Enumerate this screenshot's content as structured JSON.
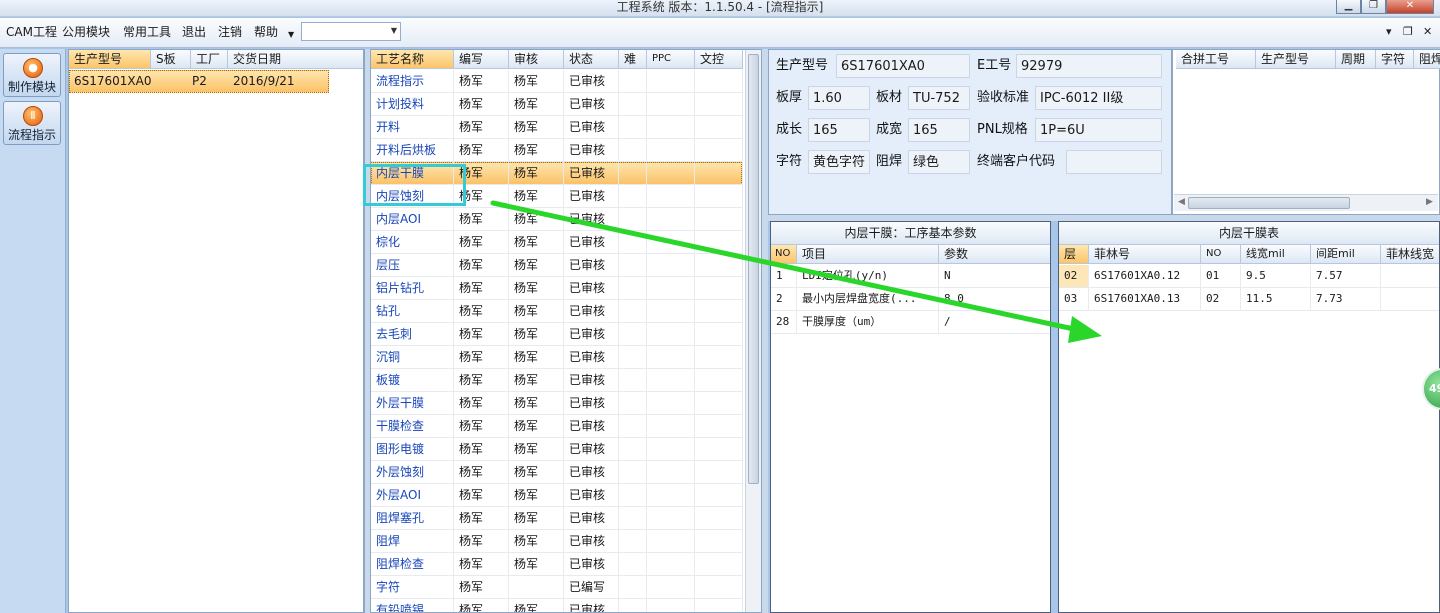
{
  "window": {
    "title": "工程系统  版本：1.1.50.4 - [流程指示]"
  },
  "menu": {
    "items": [
      "CAM工程",
      "公用模块",
      "常用工具",
      "退出",
      "注销",
      "帮助"
    ],
    "combo_value": ""
  },
  "nav": {
    "buttons": [
      {
        "label": "制作模块",
        "icon": "record-icon"
      },
      {
        "label": "流程指示",
        "icon": "pause-icon"
      }
    ]
  },
  "orders": {
    "columns": [
      "生产型号",
      "S板",
      "工厂",
      "交货日期"
    ],
    "rows": [
      [
        "6S17601XA0",
        "",
        "P2",
        "2016/9/21"
      ]
    ]
  },
  "process": {
    "columns": [
      "工艺名称",
      "编写",
      "审核",
      "状态",
      "难",
      "PPC",
      "文控"
    ],
    "rows": [
      [
        "流程指示",
        "杨军",
        "杨军",
        "已审核"
      ],
      [
        "计划投料",
        "杨军",
        "杨军",
        "已审核"
      ],
      [
        "开料",
        "杨军",
        "杨军",
        "已审核"
      ],
      [
        "开料后烘板",
        "杨军",
        "杨军",
        "已审核"
      ],
      [
        "内层干膜",
        "杨军",
        "杨军",
        "已审核"
      ],
      [
        "内层蚀刻",
        "杨军",
        "杨军",
        "已审核"
      ],
      [
        "内层AOI",
        "杨军",
        "杨军",
        "已审核"
      ],
      [
        "棕化",
        "杨军",
        "杨军",
        "已审核"
      ],
      [
        "层压",
        "杨军",
        "杨军",
        "已审核"
      ],
      [
        "铝片钻孔",
        "杨军",
        "杨军",
        "已审核"
      ],
      [
        "钻孔",
        "杨军",
        "杨军",
        "已审核"
      ],
      [
        "去毛刺",
        "杨军",
        "杨军",
        "已审核"
      ],
      [
        "沉铜",
        "杨军",
        "杨军",
        "已审核"
      ],
      [
        "板镀",
        "杨军",
        "杨军",
        "已审核"
      ],
      [
        "外层干膜",
        "杨军",
        "杨军",
        "已审核"
      ],
      [
        "干膜检查",
        "杨军",
        "杨军",
        "已审核"
      ],
      [
        "图形电镀",
        "杨军",
        "杨军",
        "已审核"
      ],
      [
        "外层蚀刻",
        "杨军",
        "杨军",
        "已审核"
      ],
      [
        "外层AOI",
        "杨军",
        "杨军",
        "已审核"
      ],
      [
        "阻焊塞孔",
        "杨军",
        "杨军",
        "已审核"
      ],
      [
        "阻焊",
        "杨军",
        "杨军",
        "已审核"
      ],
      [
        "阻焊检查",
        "杨军",
        "杨军",
        "已审核"
      ],
      [
        "字符",
        "杨军",
        "",
        "已编写"
      ],
      [
        "有铅喷锡",
        "杨军",
        "杨军",
        "已审核"
      ]
    ],
    "selected_index": 4
  },
  "info": {
    "fields": [
      {
        "label": "生产型号",
        "value": "6S17601XA0"
      },
      {
        "label": "E工号",
        "value": "92979"
      },
      {
        "label": "板厚",
        "value": "1.60"
      },
      {
        "label": "板材",
        "value": "TU-752"
      },
      {
        "label": "验收标准",
        "value": "IPC-6012 II级"
      },
      {
        "label": "成长",
        "value": "165"
      },
      {
        "label": "成宽",
        "value": "165"
      },
      {
        "label": "PNL规格",
        "value": "1P=6U"
      },
      {
        "label": "字符",
        "value": "黄色字符"
      },
      {
        "label": "阻焊",
        "value": "绿色"
      },
      {
        "label": "终端客户代码",
        "value": ""
      }
    ]
  },
  "merge": {
    "columns": [
      "合拼工号",
      "生产型号",
      "周期",
      "字符",
      "阻焊"
    ]
  },
  "params": {
    "title": "内层干膜：工序基本参数",
    "columns": [
      "NO",
      "项目",
      "参数"
    ],
    "rows": [
      [
        "1",
        "LDI定位孔(y/n)",
        "N"
      ],
      [
        "2",
        "最小内层焊盘宽度(...",
        "8.0"
      ],
      [
        "28",
        "干膜厚度（um）",
        "/"
      ]
    ]
  },
  "film": {
    "title": "内层干膜表",
    "columns": [
      "层",
      "菲林号",
      "NO",
      "线宽mil",
      "间距mil",
      "菲林线宽"
    ],
    "rows": [
      [
        "02",
        "6S17601XA0.12",
        "01",
        "9.5",
        "7.57"
      ],
      [
        "03",
        "6S17601XA0.13",
        "02",
        "11.5",
        "7.73"
      ]
    ]
  },
  "badge": {
    "text": "49"
  }
}
